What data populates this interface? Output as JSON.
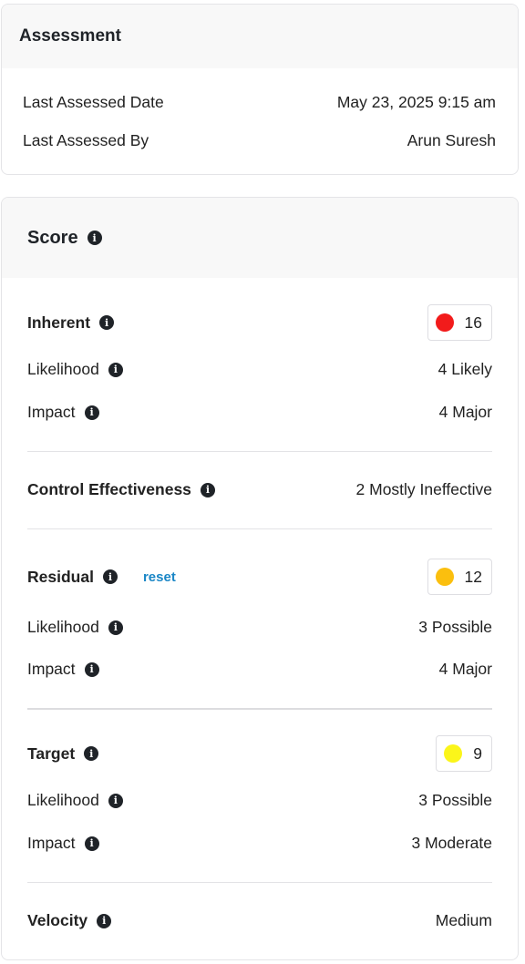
{
  "assessment": {
    "title": "Assessment",
    "rows": [
      {
        "label": "Last Assessed Date",
        "value": "May 23, 2025 9:15 am"
      },
      {
        "label": "Last Assessed By",
        "value": "Arun Suresh"
      }
    ]
  },
  "score": {
    "title": "Score",
    "inherent": {
      "label": "Inherent",
      "score": "16",
      "score_color": "#f21b1b",
      "likelihood_label": "Likelihood",
      "likelihood_value": "4 Likely",
      "impact_label": "Impact",
      "impact_value": "4 Major"
    },
    "control_effectiveness": {
      "label": "Control Effectiveness",
      "value": "2 Mostly Ineffective"
    },
    "residual": {
      "label": "Residual",
      "reset_label": "reset",
      "score": "12",
      "score_color": "#fbbf0e",
      "likelihood_label": "Likelihood",
      "likelihood_value": "3 Possible",
      "impact_label": "Impact",
      "impact_value": "4 Major"
    },
    "target": {
      "label": "Target",
      "score": "9",
      "score_color": "#fbf51a",
      "likelihood_label": "Likelihood",
      "likelihood_value": "3 Possible",
      "impact_label": "Impact",
      "impact_value": "3 Moderate"
    },
    "velocity": {
      "label": "Velocity",
      "value": "Medium"
    }
  },
  "icons": {
    "info": "info-icon"
  }
}
